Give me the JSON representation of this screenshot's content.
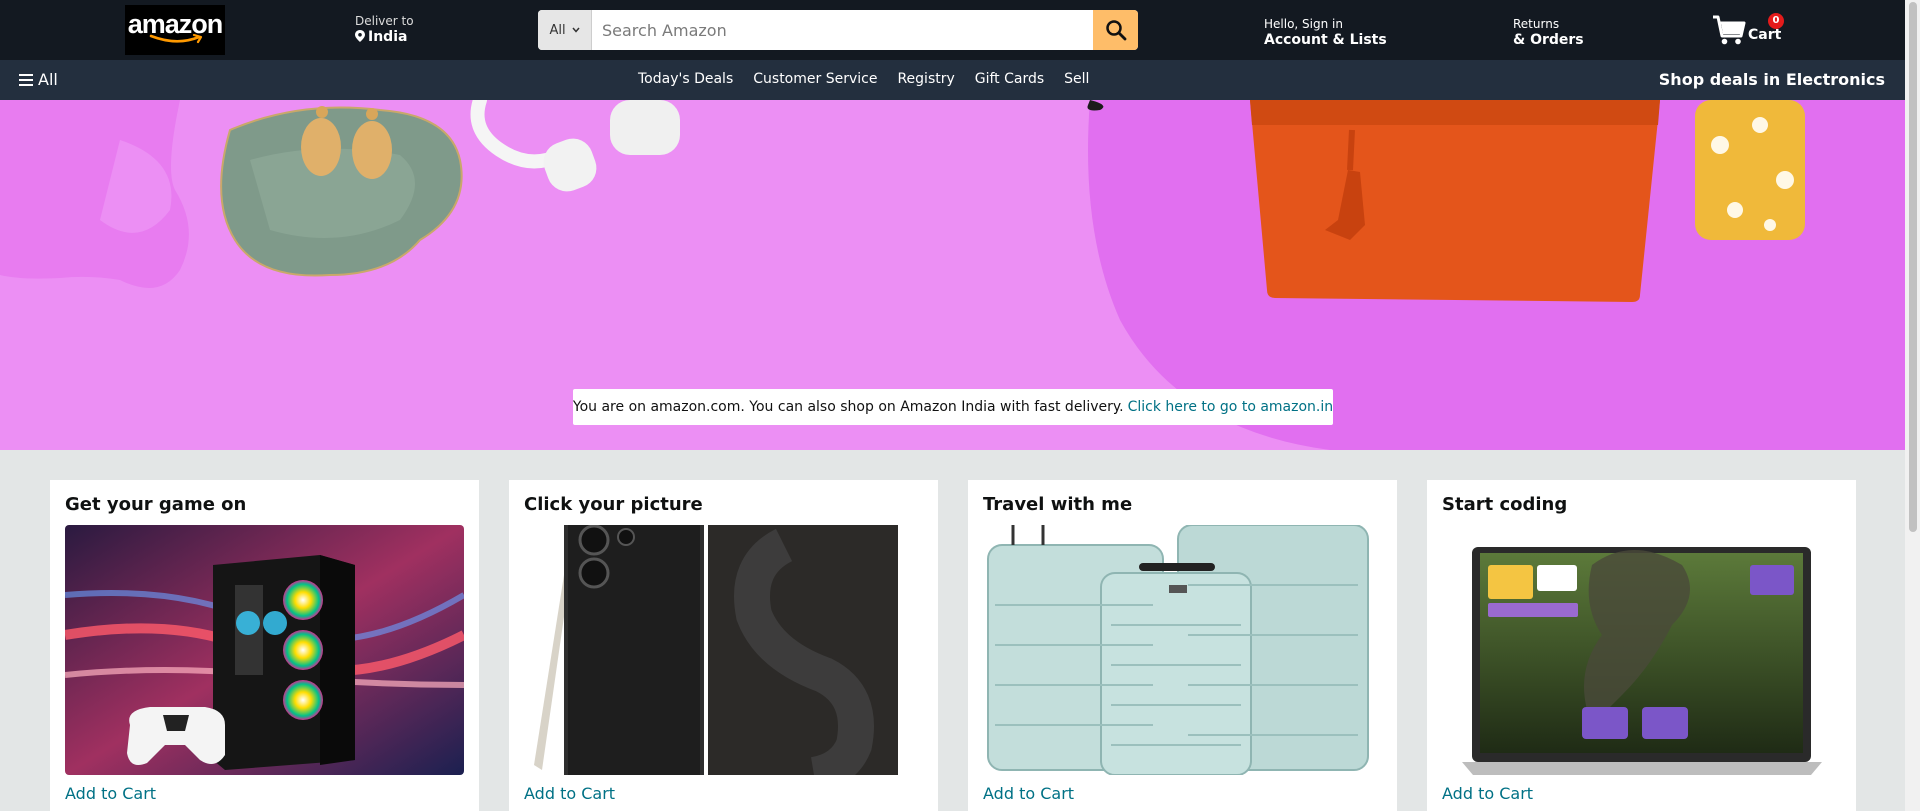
{
  "header": {
    "logo_text": "amazon",
    "deliver_small": "Deliver to",
    "deliver_location": "India",
    "search_category": "All",
    "search_placeholder": "Search Amazon",
    "account_small": "Hello, Sign in",
    "account_big": "Account & Lists",
    "returns_small": "Returns",
    "returns_big": "& Orders",
    "cart_count": "0",
    "cart_label": "Cart"
  },
  "subnav": {
    "all_label": "All",
    "links": [
      "Today's Deals",
      "Customer Service",
      "Registry",
      "Gift Cards",
      "Sell"
    ],
    "promo": "Shop deals in Electronics"
  },
  "hero": {
    "notice_text": "You are on amazon.com. You can also shop on Amazon India with fast delivery.",
    "notice_link": "Click here to go to amazon.in"
  },
  "cards": [
    {
      "title": "Get your game on",
      "action": "Add to Cart"
    },
    {
      "title": "Click your picture",
      "action": "Add to Cart"
    },
    {
      "title": "Travel with me",
      "action": "Add to Cart"
    },
    {
      "title": "Start coding",
      "action": "Add to Cart"
    }
  ],
  "colors": {
    "nav_dark": "#131921",
    "subnav": "#232f3e",
    "search_button": "#febd69",
    "hero_bg": "#ec8ff4",
    "link": "#007185",
    "badge": "#e41b1b"
  },
  "icons": [
    "map-pin-icon",
    "search-icon",
    "cart-icon",
    "hamburger-icon",
    "chevron-down-icon"
  ]
}
